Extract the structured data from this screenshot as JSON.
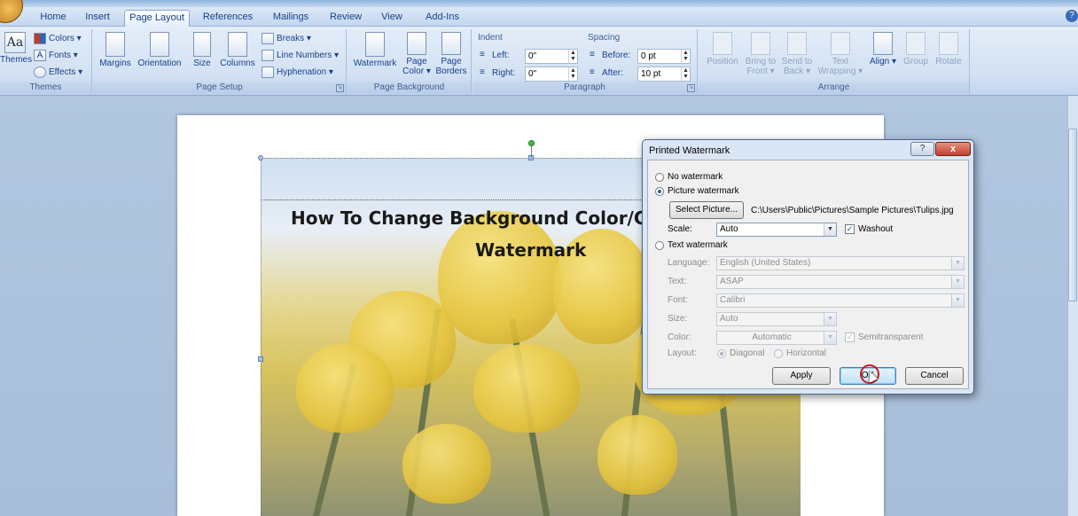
{
  "tabs": [
    {
      "label": "Home"
    },
    {
      "label": "Insert"
    },
    {
      "label": "Page Layout",
      "active": true
    },
    {
      "label": "References"
    },
    {
      "label": "Mailings"
    },
    {
      "label": "Review"
    },
    {
      "label": "View"
    },
    {
      "label": "Add-Ins"
    }
  ],
  "ribbon": {
    "themes": {
      "themes_label": "Themes",
      "colors_label": "Colors",
      "fonts_label": "Fonts",
      "effects_label": "Effects",
      "group_label": "Themes"
    },
    "page_setup": {
      "margins_label": "Margins",
      "orientation_label": "Orientation",
      "size_label": "Size",
      "columns_label": "Columns",
      "breaks_label": "Breaks",
      "line_numbers_label": "Line Numbers",
      "hyphenation_label": "Hyphenation",
      "group_label": "Page Setup"
    },
    "page_background": {
      "watermark_label": "Watermark",
      "page_color_label_1": "Page",
      "page_color_label_2": "Color",
      "page_borders_label_1": "Page",
      "page_borders_label_2": "Borders",
      "group_label": "Page Background"
    },
    "paragraph": {
      "indent_label": "Indent",
      "left_label": "Left:",
      "left_value": "0\"",
      "right_label": "Right:",
      "right_value": "0\"",
      "spacing_label": "Spacing",
      "before_label": "Before:",
      "before_value": "0 pt",
      "after_label": "After:",
      "after_value": "10 pt",
      "group_label": "Paragraph"
    },
    "arrange": {
      "position_label": "Position",
      "bring_to_front_label_1": "Bring to",
      "bring_to_front_label_2": "Front",
      "send_to_back_label_1": "Send to",
      "send_to_back_label_2": "Back",
      "text_wrapping_label_1": "Text",
      "text_wrapping_label_2": "Wrapping",
      "align_label": "Align",
      "group_label_btn": "Group",
      "rotate_label": "Rotate",
      "group_label": "Arrange"
    }
  },
  "document": {
    "title_line1": "How To Change Background Color/C",
    "title_line2": "Watermark"
  },
  "dialog": {
    "title": "Printed Watermark",
    "help_label": "?",
    "close_label": "x",
    "no_watermark_label": "No watermark",
    "picture_watermark_label": "Picture watermark",
    "select_picture_label": "Select Picture...",
    "picture_path": "C:\\Users\\Public\\Pictures\\Sample Pictures\\Tulips.jpg",
    "scale_label": "Scale:",
    "scale_value": "Auto",
    "washout_label": "Washout",
    "text_watermark_label": "Text watermark",
    "language_label": "Language:",
    "language_value": "English (United States)",
    "text_label": "Text:",
    "text_value": "ASAP",
    "font_label": "Font:",
    "font_value": "Calibri",
    "size_label": "Size:",
    "size_value": "Auto",
    "color_label": "Color:",
    "color_value": "Automatic",
    "semitransparent_label": "Semitransparent",
    "layout_label": "Layout:",
    "diagonal_label": "Diagonal",
    "horizontal_label": "Horizontal",
    "apply_label": "Apply",
    "ok_label": "OK",
    "cancel_label": "Cancel"
  }
}
